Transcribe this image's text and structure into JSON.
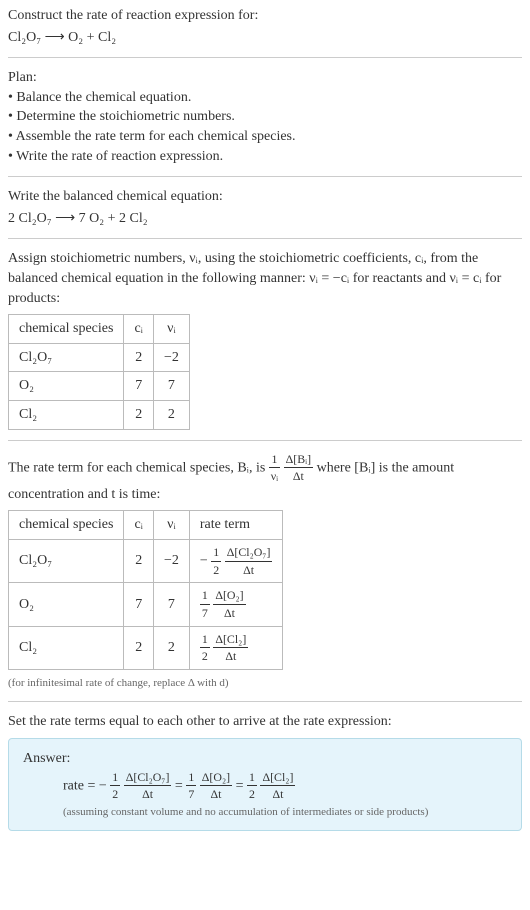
{
  "prompt_line1": "Construct the rate of reaction expression for:",
  "unbalanced": "Cl₂O₇ ⟶ O₂ + Cl₂",
  "plan_heading": "Plan:",
  "plan_items": [
    "• Balance the chemical equation.",
    "• Determine the stoichiometric numbers.",
    "• Assemble the rate term for each chemical species.",
    "• Write the rate of reaction expression."
  ],
  "balanced_heading": "Write the balanced chemical equation:",
  "balanced": "2 Cl₂O₇ ⟶ 7 O₂ + 2 Cl₂",
  "stoich_intro_a": "Assign stoichiometric numbers, νᵢ, using the stoichiometric coefficients, cᵢ, from the balanced chemical equation in the following manner: νᵢ = −cᵢ for reactants and νᵢ = cᵢ for products:",
  "table1": {
    "head": [
      "chemical species",
      "cᵢ",
      "νᵢ"
    ],
    "rows": [
      [
        "Cl₂O₇",
        "2",
        "−2"
      ],
      [
        "O₂",
        "7",
        "7"
      ],
      [
        "Cl₂",
        "2",
        "2"
      ]
    ]
  },
  "rate_term_intro_a": "The rate term for each chemical species, Bᵢ, is ",
  "rate_term_intro_b": " where [Bᵢ] is the amount concentration and t is time:",
  "table2": {
    "head": [
      "chemical species",
      "cᵢ",
      "νᵢ",
      "rate term"
    ],
    "rows": [
      {
        "sp": "Cl₂O₇",
        "c": "2",
        "v": "−2",
        "sign": "−",
        "fa": "1",
        "fb": "2",
        "num": "Δ[Cl₂O₇]",
        "den": "Δt"
      },
      {
        "sp": "O₂",
        "c": "7",
        "v": "7",
        "sign": "",
        "fa": "1",
        "fb": "7",
        "num": "Δ[O₂]",
        "den": "Δt"
      },
      {
        "sp": "Cl₂",
        "c": "2",
        "v": "2",
        "sign": "",
        "fa": "1",
        "fb": "2",
        "num": "Δ[Cl₂]",
        "den": "Δt"
      }
    ]
  },
  "inf_note": "(for infinitesimal rate of change, replace Δ with d)",
  "set_equal": "Set the rate terms equal to each other to arrive at the rate expression:",
  "answer_label": "Answer:",
  "rate_label": "rate = ",
  "eq": " = ",
  "answer_note": "(assuming constant volume and no accumulation of intermediates or side products)",
  "chart_data": {
    "type": "table",
    "title": "Stoichiometric numbers and rate terms",
    "tables": [
      {
        "columns": [
          "chemical species",
          "c_i",
          "ν_i"
        ],
        "rows": [
          [
            "Cl2O7",
            2,
            -2
          ],
          [
            "O2",
            7,
            7
          ],
          [
            "Cl2",
            2,
            2
          ]
        ]
      },
      {
        "columns": [
          "chemical species",
          "c_i",
          "ν_i",
          "rate term"
        ],
        "rows": [
          [
            "Cl2O7",
            2,
            -2,
            "-(1/2) Δ[Cl2O7]/Δt"
          ],
          [
            "O2",
            7,
            7,
            "(1/7) Δ[O2]/Δt"
          ],
          [
            "Cl2",
            2,
            2,
            "(1/2) Δ[Cl2]/Δt"
          ]
        ]
      }
    ],
    "rate_expression": "rate = -(1/2) Δ[Cl2O7]/Δt = (1/7) Δ[O2]/Δt = (1/2) Δ[Cl2]/Δt"
  }
}
